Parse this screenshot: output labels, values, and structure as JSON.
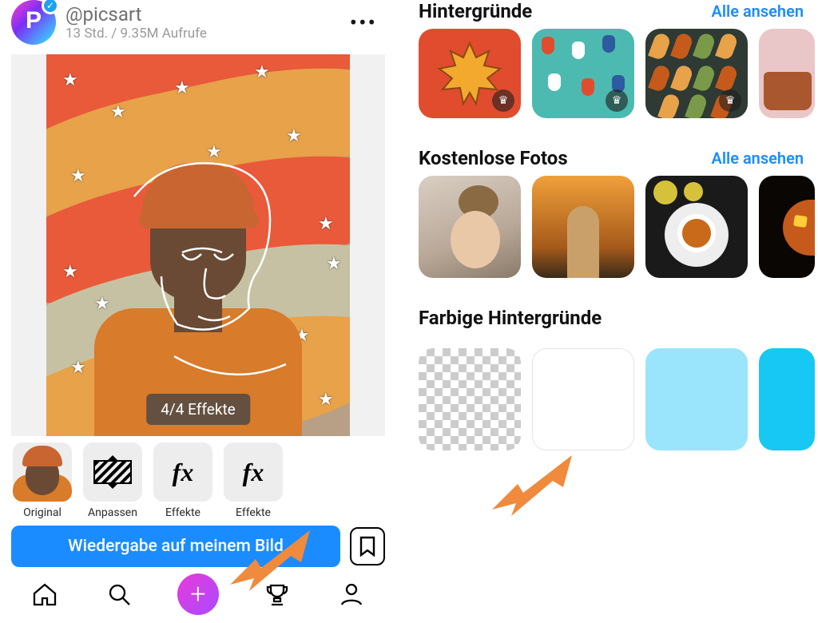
{
  "post": {
    "username": "@picsart",
    "meta": "13 Std. / 9.35M Aufrufe",
    "effects_badge": "4/4 Effekte",
    "cta": "Wiedergabe auf meinem Bild"
  },
  "thumbs": [
    {
      "label": "Original"
    },
    {
      "label": "Anpassen"
    },
    {
      "label": "Effekte"
    },
    {
      "label": "Effekte"
    }
  ],
  "sections": {
    "backgrounds": {
      "title": "Hintergründe",
      "see_all": "Alle ansehen"
    },
    "free_photos": {
      "title": "Kostenlose Fotos",
      "see_all": "Alle ansehen"
    },
    "colored_bg": {
      "title": "Farbige Hintergründe"
    }
  }
}
